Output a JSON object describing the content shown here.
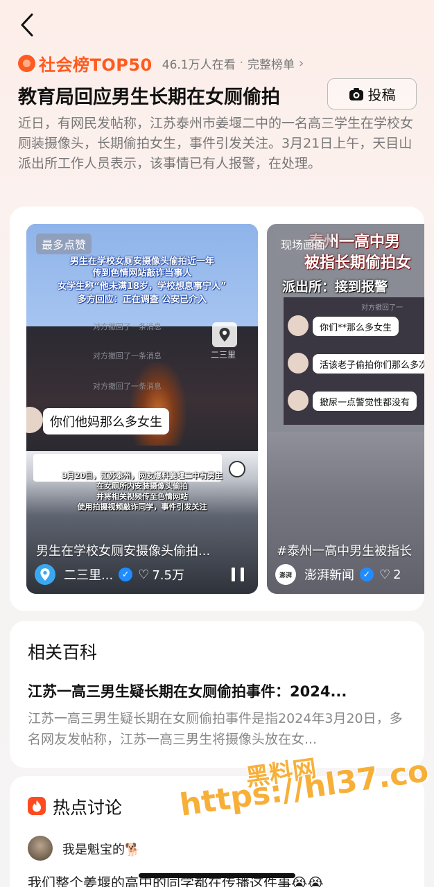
{
  "header": {
    "rank_label": "社会榜TOP50",
    "viewers": "46.1万人在看",
    "separator": "·",
    "full_list": "完整榜单",
    "chevron": "›"
  },
  "topic": {
    "headline": "教育局回应男生长期在女厕偷拍",
    "submit_label": "投稿",
    "summary": "近日，有网民发帖称，江苏泰州市姜堰二中的一名高三学生在学校女厕装摄像头，长期偷拍女生，事件引发关注。3月21日上午，天目山派出所工作人员表示，该事情已有人报警，在处理。"
  },
  "videos": [
    {
      "tag": "最多点赞",
      "caption_lines": [
        "男生在学校女厕安摄像头偷拍近一年",
        "传到色情网站敲诈当事人",
        "女学生称“他未满18岁，学校想息事宁人”",
        "多方回应：正在调查 公安已介入"
      ],
      "system_messages": [
        "对方撤回了一条消息",
        "对方撤回了一条消息",
        "对方撤回了一条消息"
      ],
      "location_label": "二三里",
      "chat_message": "你们他妈那么多女生",
      "subtitle_lines": [
        "3月20日，江苏泰州，网友爆料姜堰二中有男生",
        "在女厕所内安装摄像头偷拍",
        "并将相关视频传至色情网站",
        "使用拍摄视频敲诈同学，事件引发关注"
      ],
      "title": "男生在学校女厕安摄像头偷拍...",
      "author": "二三里...",
      "likes": "7.5万",
      "avatar_color": "#3aa8f0"
    },
    {
      "tag": "现场画面",
      "overlay_title_1": "泰州一高中男",
      "overlay_title_2": "被指长期偷拍女",
      "overlay_sub": "派出所：接到报警",
      "chat_header": "对方撤回了一",
      "chat_messages": [
        "你们**那么多女生",
        "活该老子偷拍你们那么多次",
        "撤尿一点警觉性都没有"
      ],
      "title": "#泰州一高中男生被指长",
      "author": "澎湃新闻",
      "likes": "2",
      "avatar_text": "澎湃"
    }
  ],
  "baike": {
    "heading": "相关百科",
    "title": "江苏一高三男生疑长期在女厕偷拍事件：2024...",
    "description": "江苏一高三男生疑长期在女厕偷拍事件是指2024年3月20日，多名网友发帖称，江苏一高三男生将摄像头放在女..."
  },
  "hot": {
    "heading": "热点讨论",
    "user_name": "我是魁宝的🐕",
    "post_text": "我们整个姜堰的高中的同学都在传播这件事😭😭"
  },
  "watermark": {
    "line1": "黑料网",
    "line2": "https://hl37.co"
  },
  "colors": {
    "brand_orange": "#ff5a1f",
    "verify_blue": "#1f8cff",
    "watermark": "#f6b03a"
  }
}
